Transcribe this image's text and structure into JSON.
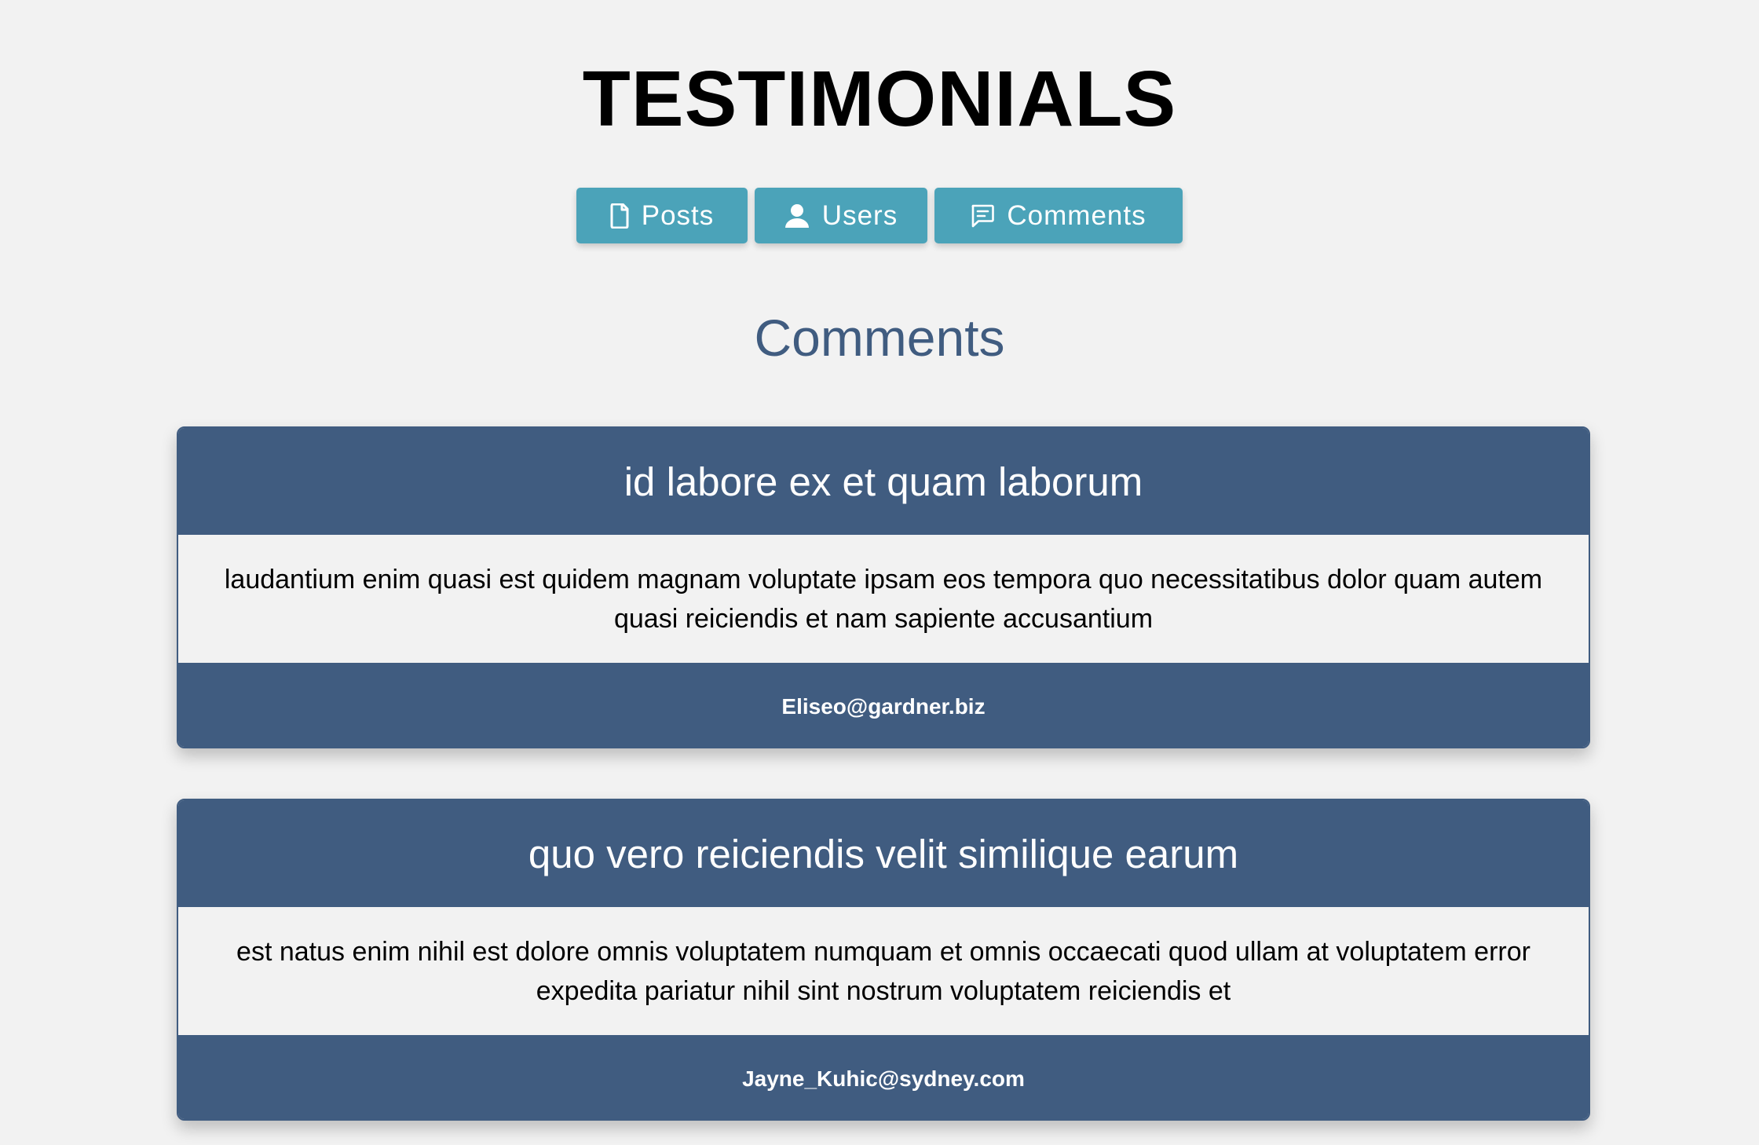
{
  "header": {
    "title": "TESTIMONIALS"
  },
  "nav": {
    "buttons": [
      {
        "label": "Posts",
        "icon": "document-icon"
      },
      {
        "label": "Users",
        "icon": "user-icon"
      },
      {
        "label": "Comments",
        "icon": "comment-icon"
      }
    ]
  },
  "section": {
    "title": "Comments"
  },
  "comments": [
    {
      "title": "id labore ex et quam laborum",
      "body": "laudantium enim quasi est quidem magnam voluptate ipsam eos tempora quo necessitatibus dolor quam autem quasi reiciendis et nam sapiente accusantium",
      "email": "Eliseo@gardner.biz"
    },
    {
      "title": "quo vero reiciendis velit similique earum",
      "body": "est natus enim nihil est dolore omnis voluptatem numquam et omnis occaecati quod ullam at voluptatem error expedita pariatur nihil sint nostrum voluptatem reiciendis et",
      "email": "Jayne_Kuhic@sydney.com"
    }
  ],
  "colors": {
    "background": "#f2f2f2",
    "nav_button": "#4ba3b9",
    "card_accent": "#405c80",
    "section_title": "#405c80"
  }
}
